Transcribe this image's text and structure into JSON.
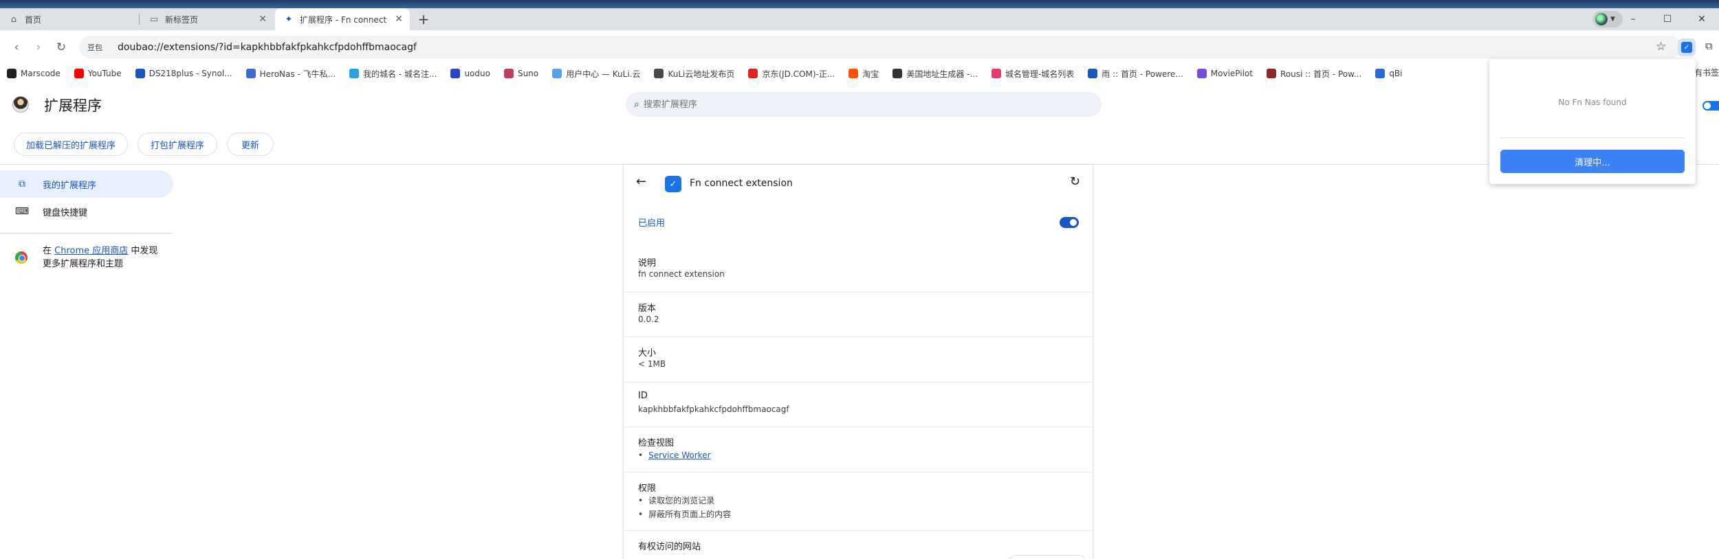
{
  "tabs": [
    {
      "label": "首页",
      "icon": "home-icon"
    },
    {
      "label": "新标签页",
      "icon": "page-icon"
    },
    {
      "label": "扩展程序 - Fn connect",
      "icon": "puzzle-icon"
    }
  ],
  "omnibox": {
    "chip": "豆包",
    "url": "doubao://extensions/?id=kapkhbbfakfpkahkcfpdohffbmaocagf"
  },
  "bookmarks": [
    {
      "label": "Marscode",
      "color": "#202124"
    },
    {
      "label": "YouTube",
      "color": "#ff0000"
    },
    {
      "label": "DS218plus - Synol...",
      "color": "#1a56c4"
    },
    {
      "label": "HeroNas - 飞牛私...",
      "color": "#3c6bd8"
    },
    {
      "label": "我的城名 - 城名注...",
      "color": "#2ca0e0"
    },
    {
      "label": "uoduo",
      "color": "#2946c8"
    },
    {
      "label": "Suno",
      "color": "#c43a5a"
    },
    {
      "label": "用户中心 — KuLi.云",
      "color": "#5aa0e8"
    },
    {
      "label": "KuLi云地址发布页",
      "color": "#4a4a4a"
    },
    {
      "label": "京东(JD.COM)-正...",
      "color": "#e1251b"
    },
    {
      "label": "淘宝",
      "color": "#ff5000"
    },
    {
      "label": "美国地址生成器 -...",
      "color": "#333333"
    },
    {
      "label": "城名管理-城名列表",
      "color": "#e83a6a"
    },
    {
      "label": "雨 :: 首页 - Powere...",
      "color": "#1a56c4"
    },
    {
      "label": "MoviePilot",
      "color": "#7a4ae0"
    },
    {
      "label": "Rousi :: 首页 - Pow...",
      "color": "#8a2a2a"
    },
    {
      "label": "qBi",
      "color": "#2a6ad8"
    }
  ],
  "bookmarks_more": "有书签",
  "header": {
    "title": "扩展程序",
    "search_placeholder": "搜索扩展程序",
    "buttons": [
      "加载已解压的扩展程序",
      "打包扩展程序",
      "更新"
    ]
  },
  "sidebar": {
    "items": [
      {
        "label": "我的扩展程序",
        "active": true
      },
      {
        "label": "键盘快捷键",
        "active": false
      }
    ],
    "store_pre": "在 ",
    "store_link": "Chrome 应用商店",
    "store_post": " 中发现更多扩展程序和主题"
  },
  "details": {
    "name": "Fn connect extension",
    "enabled_label": "已启用",
    "enabled": true,
    "description_label": "说明",
    "description": "fn connect extension",
    "version_label": "版本",
    "version": "0.0.2",
    "size_label": "大小",
    "size": "< 1MB",
    "id_label": "ID",
    "id": "kapkhbbfakfpkahkcfpdohffbmaocagf",
    "inspect_label": "检查视图",
    "inspect_link": "Service Worker",
    "permissions_label": "权限",
    "permissions": [
      "读取您的浏览记录",
      "屏蔽所有页面上的内容"
    ],
    "site_access_label": "有权访问的网站"
  },
  "popup": {
    "message": "No Fn Nas found",
    "button": "清理中..."
  }
}
